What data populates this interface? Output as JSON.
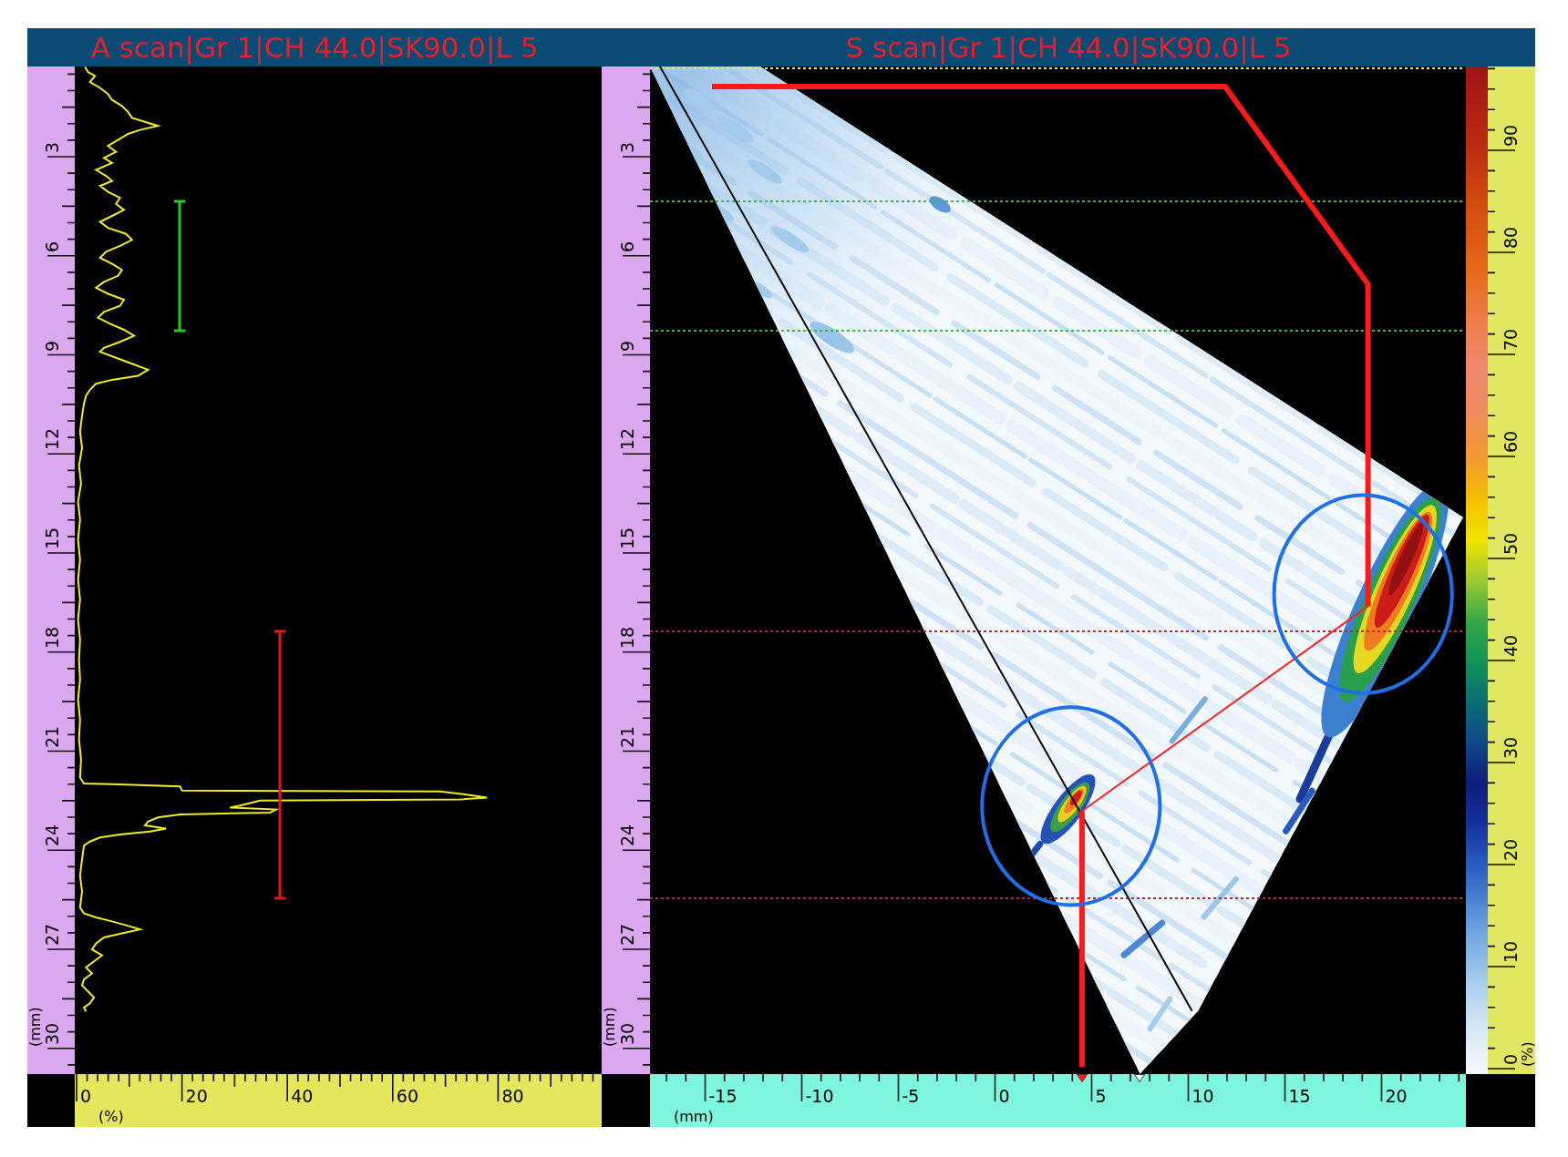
{
  "a_scan": {
    "title": "A scan|Gr 1|CH 44.0|SK90.0|L 5",
    "depth_ruler": {
      "labels": [
        "3",
        "6",
        "9",
        "12",
        "15",
        "18",
        "21",
        "24",
        "27",
        "30"
      ],
      "unit": "(mm)"
    },
    "amplitude_ruler": {
      "labels": [
        "0",
        "20",
        "40",
        "60",
        "80"
      ],
      "unit": "(%)"
    }
  },
  "s_scan": {
    "title": "S scan|Gr 1|CH 44.0|SK90.0|L 5",
    "depth_ruler": {
      "labels": [
        "3",
        "6",
        "9",
        "12",
        "15",
        "18",
        "21",
        "24",
        "27",
        "30"
      ],
      "unit": "(mm)"
    },
    "index_ruler": {
      "labels": [
        "-15",
        "-10",
        "-5",
        "0",
        "5",
        "10",
        "15",
        "20"
      ],
      "unit": "(mm)"
    },
    "color_scale": {
      "labels": [
        "0",
        "10",
        "20",
        "30",
        "40",
        "50",
        "60",
        "70",
        "80",
        "90"
      ],
      "unit": "(%)"
    }
  },
  "gates": [
    {
      "color": "#22cc22"
    },
    {
      "color": "#e01818"
    }
  ]
}
